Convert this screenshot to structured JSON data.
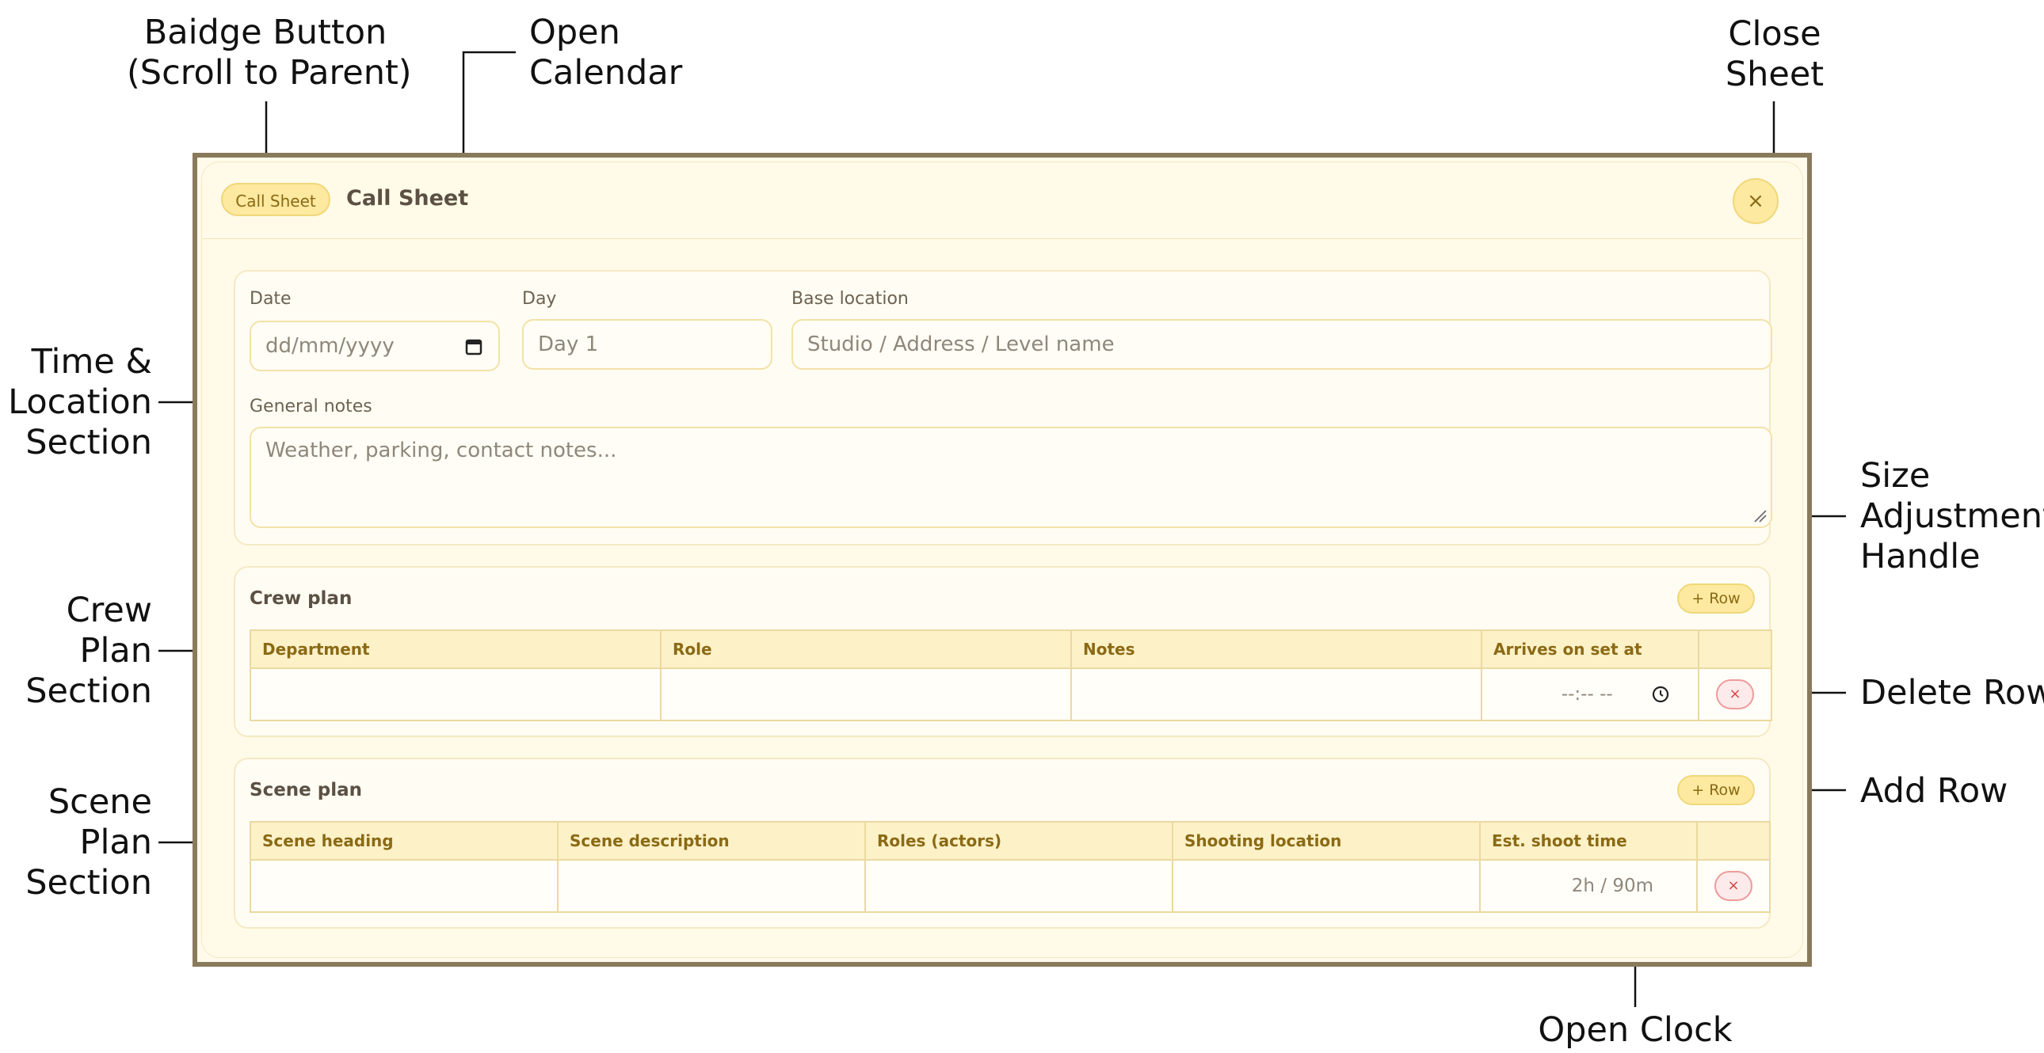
{
  "callouts": {
    "badge": [
      "Baidge Button",
      "(Scroll to Parent)"
    ],
    "calendar": [
      "Open",
      "Calendar"
    ],
    "close": [
      "Close",
      "Sheet"
    ],
    "time_section": [
      "Time &",
      "Location",
      "Section"
    ],
    "size_handle": [
      "Size",
      "Adjustment",
      "Handle"
    ],
    "crew_section": [
      "Crew",
      "Plan",
      "Section"
    ],
    "delete_row": [
      "Delete Row"
    ],
    "scene_section": [
      "Scene",
      "Plan",
      "Section"
    ],
    "add_row": [
      "Add Row"
    ],
    "clock": [
      "Open Clock"
    ]
  },
  "sheet": {
    "badge_label": "Call Sheet",
    "title": "Call Sheet",
    "close_label": "×"
  },
  "time_location": {
    "date_label": "Date",
    "date_placeholder": "dd/mm/yyyy",
    "day_label": "Day",
    "day_placeholder": "Day 1",
    "base_label": "Base location",
    "base_placeholder": "Studio / Address / Level name",
    "notes_label": "General notes",
    "notes_placeholder": "Weather, parking, contact notes..."
  },
  "crew_plan": {
    "title": "Crew plan",
    "add_row_label": "+ Row",
    "columns": [
      "Department",
      "Role",
      "Notes",
      "Arrives on set at"
    ],
    "time_placeholder": "--:-- --",
    "delete_label": "×"
  },
  "scene_plan": {
    "title": "Scene plan",
    "add_row_label": "+ Row",
    "columns": [
      "Scene heading",
      "Scene description",
      "Roles (actors)",
      "Shooting location",
      "Est. shoot time"
    ],
    "time_placeholder": "2h / 90m",
    "delete_label": "×"
  },
  "colors": {
    "accent": "#fde9a0",
    "accent_text": "#8a6a14",
    "delete": "#d64545",
    "frame": "#8a7a5c"
  }
}
